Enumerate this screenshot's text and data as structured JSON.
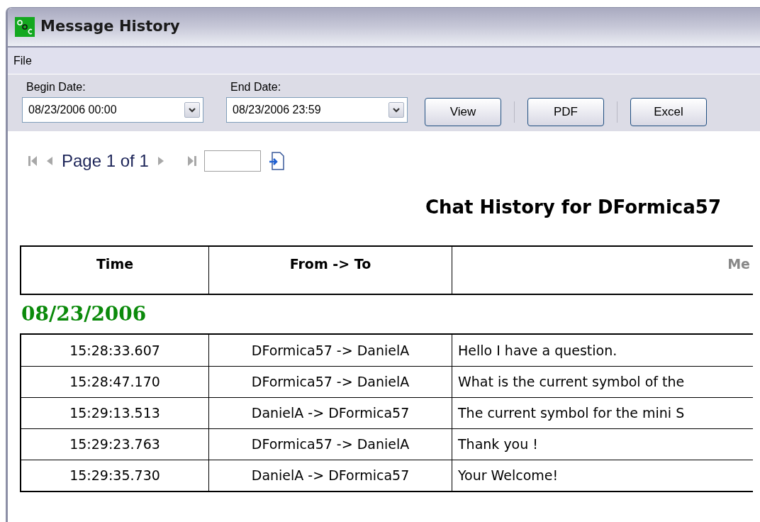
{
  "window": {
    "title": "Message History"
  },
  "menu": [
    "File"
  ],
  "filters": [
    {
      "label": "Begin Date:",
      "value": "08/23/2006 00:00"
    },
    {
      "label": "End Date:",
      "value": "08/23/2006 23:59"
    }
  ],
  "buttons": [
    "View",
    "PDF",
    "Excel"
  ],
  "pager": {
    "text": "Page 1 of 1"
  },
  "report": {
    "title": "Chat History for DFormica57",
    "columns": [
      "Time",
      "From -> To",
      "Me"
    ],
    "date": "08/23/2006",
    "rows": [
      [
        "15:28:33.607",
        "DFormica57 -> DanielA",
        "Hello I have a question."
      ],
      [
        "15:28:47.170",
        "DFormica57 -> DanielA",
        "What is the current symbol of the"
      ],
      [
        "15:29:13.513",
        "DanielA -> DFormica57",
        "The current symbol for the mini S"
      ],
      [
        "15:29:23.763",
        "DFormica57 -> DanielA",
        "Thank you !"
      ],
      [
        "15:29:35.730",
        "DanielA -> DFormica57",
        "Your Welcome!"
      ]
    ]
  }
}
